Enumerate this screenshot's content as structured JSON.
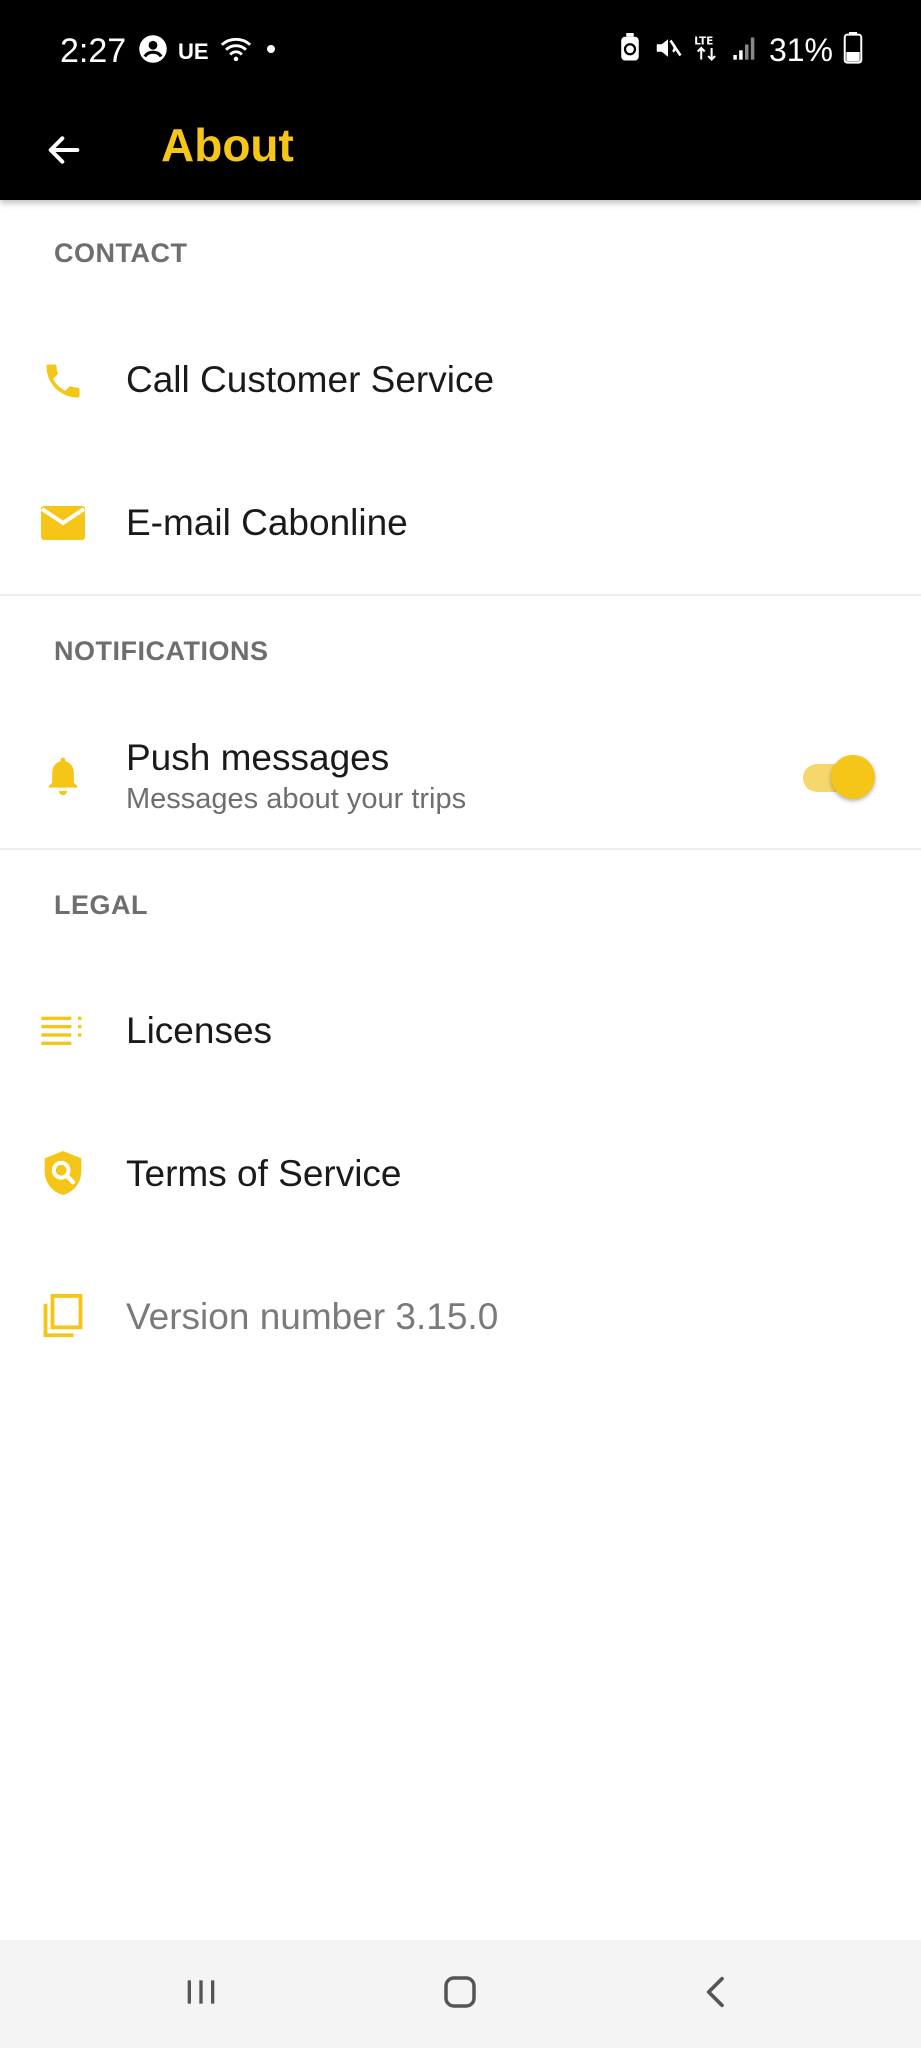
{
  "status_bar": {
    "time": "2:27",
    "carrier": "UE",
    "battery": "31%"
  },
  "app_bar": {
    "title": "About",
    "accent_color": "#F5C518"
  },
  "sections": {
    "contact": {
      "header": "CONTACT",
      "items": [
        {
          "label": "Call Customer Service",
          "icon": "phone-icon"
        },
        {
          "label": "E-mail Cabonline",
          "icon": "mail-icon"
        }
      ]
    },
    "notifications": {
      "header": "NOTIFICATIONS",
      "items": [
        {
          "label": "Push messages",
          "subtitle": "Messages about your trips",
          "icon": "bell-icon",
          "toggle_on": true
        }
      ]
    },
    "legal": {
      "header": "LEGAL",
      "items": [
        {
          "label": "Licenses",
          "icon": "list-icon"
        },
        {
          "label": "Terms of Service",
          "icon": "shield-search-icon"
        },
        {
          "label": "Version number 3.15.0",
          "icon": "copy-icon"
        }
      ]
    }
  },
  "nav_bar": {
    "buttons": [
      "recent-apps",
      "home",
      "back"
    ]
  }
}
